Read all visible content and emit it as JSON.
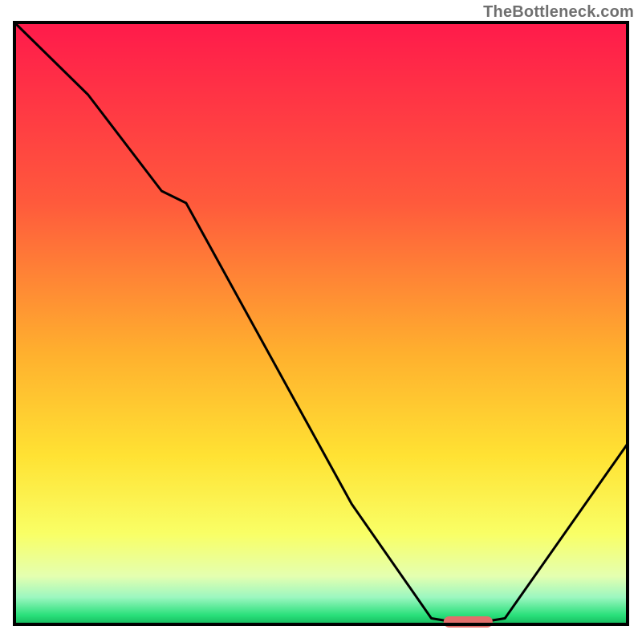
{
  "watermark": "TheBottleneck.com",
  "chart_data": {
    "type": "line",
    "title": "",
    "xlabel": "",
    "ylabel": "",
    "xlim": [
      0,
      100
    ],
    "ylim": [
      0,
      100
    ],
    "x": [
      0,
      12,
      24,
      28,
      55,
      68,
      74,
      80,
      100
    ],
    "values": [
      100,
      88,
      72,
      70,
      20,
      1,
      0,
      1,
      30
    ],
    "marker": {
      "x_start": 70,
      "x_end": 78,
      "y": 0
    },
    "gradient_stops": [
      {
        "offset": 0.0,
        "color": "#ff1a4b"
      },
      {
        "offset": 0.3,
        "color": "#ff5a3c"
      },
      {
        "offset": 0.55,
        "color": "#ffb02e"
      },
      {
        "offset": 0.72,
        "color": "#ffe233"
      },
      {
        "offset": 0.85,
        "color": "#f9ff66"
      },
      {
        "offset": 0.92,
        "color": "#e4ffb0"
      },
      {
        "offset": 0.955,
        "color": "#9cf7c0"
      },
      {
        "offset": 0.985,
        "color": "#29e07a"
      },
      {
        "offset": 1.0,
        "color": "#16b85d"
      }
    ],
    "colors": {
      "curve": "#000000",
      "frame": "#000000",
      "marker": "#e26f6b"
    }
  }
}
